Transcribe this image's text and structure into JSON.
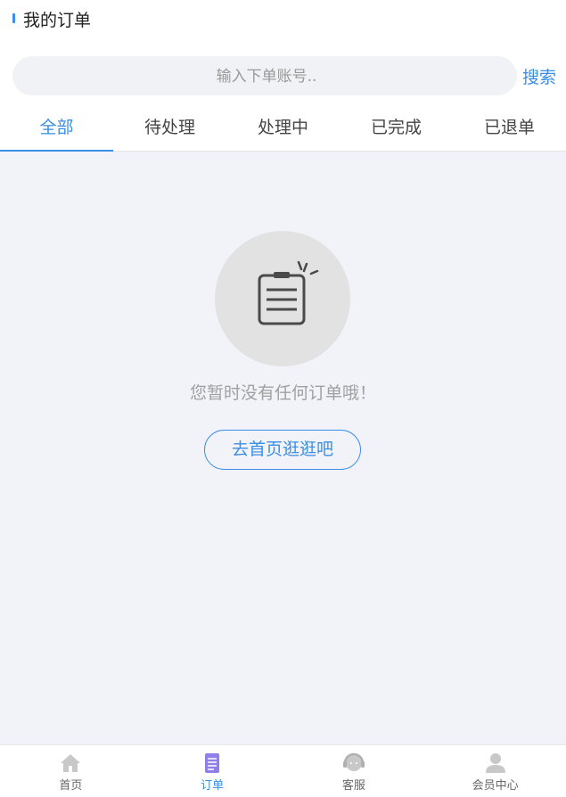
{
  "header": {
    "title": "我的订单"
  },
  "search": {
    "placeholder": "输入下单账号..",
    "value": "",
    "button": "搜索"
  },
  "tabs": [
    {
      "label": "全部",
      "active": true
    },
    {
      "label": "待处理"
    },
    {
      "label": "处理中"
    },
    {
      "label": "已完成"
    },
    {
      "label": "已退单"
    }
  ],
  "empty": {
    "icon": "clipboard-icon",
    "text": "您暂时没有任何订单哦！",
    "button": "去首页逛逛吧"
  },
  "tabbar": [
    {
      "label": "首页",
      "icon": "home-icon"
    },
    {
      "label": "订单",
      "icon": "order-icon",
      "active": true
    },
    {
      "label": "客服",
      "icon": "customer-service-icon"
    },
    {
      "label": "会员中心",
      "icon": "user-icon"
    }
  ],
  "colors": {
    "accent": "#3a8ee6",
    "background": "#f2f3f8",
    "icon_gray": "#c8c8c8",
    "order_icon": "#8f7fe8"
  }
}
